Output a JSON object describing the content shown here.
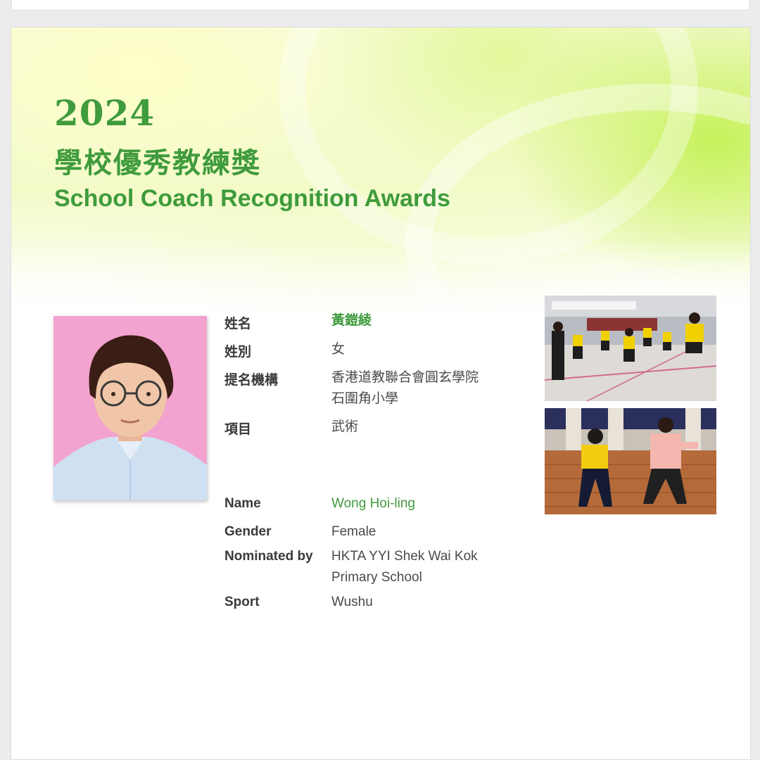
{
  "header": {
    "year": "2024",
    "title_zh": "學校優秀教練獎",
    "title_en": "School Coach Recognition Awards"
  },
  "profile": {
    "zh": [
      {
        "label": "姓名",
        "value": "黃鎧綾",
        "highlight": true
      },
      {
        "label": "姓別",
        "value": "女"
      },
      {
        "label": "提名機構",
        "value": "香港道教聯合會圓玄學院",
        "value2": "石圍角小學"
      },
      {
        "label": "項目",
        "value": "武術"
      }
    ],
    "en": [
      {
        "label": "Name",
        "value": "Wong Hoi-ling",
        "highlight": true
      },
      {
        "label": "Gender",
        "value": "Female"
      },
      {
        "label": "Nominated by",
        "value": "HKTA YYI Shek Wai Kok",
        "value2": "Primary School"
      },
      {
        "label": "Sport",
        "value": "Wushu"
      }
    ]
  },
  "colors": {
    "accent_green": "#3f9b3c",
    "portrait_bg": "#f3a3cf"
  }
}
